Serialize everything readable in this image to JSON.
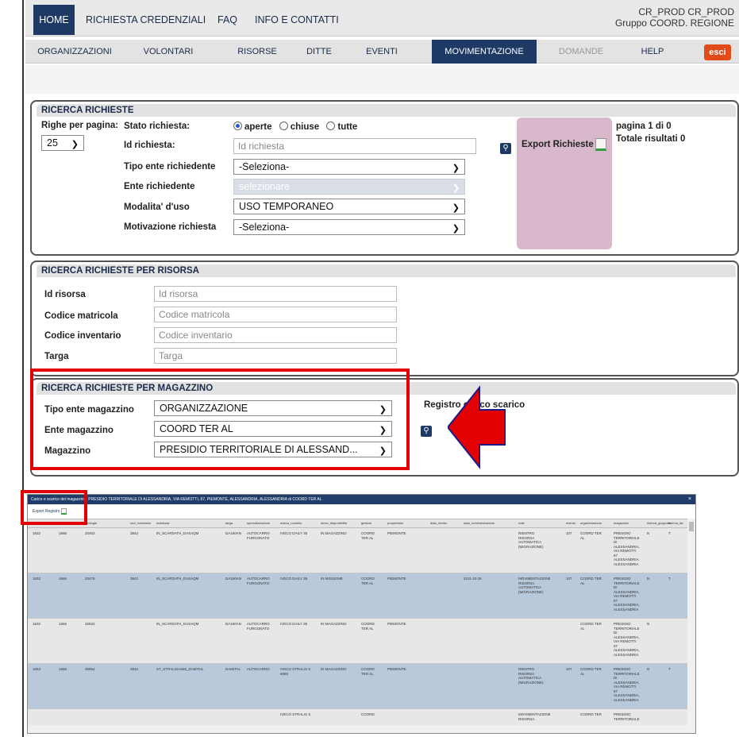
{
  "topbar": {
    "tabs": [
      "HOME",
      "RICHIESTA CREDENZIALI",
      "FAQ",
      "INFO E CONTATTI"
    ],
    "user_line1": "CR_PROD CR_PROD",
    "user_line2": "Gruppo COORD. REGIONE"
  },
  "nav": {
    "items": [
      "ORGANIZZAZIONI",
      "VOLONTARI",
      "RISORSE",
      "DITTE",
      "EVENTI",
      "MOVIMENTAZIONE",
      "DOMANDE",
      "HELP"
    ],
    "active": "MOVIMENTAZIONE",
    "logout": "esci"
  },
  "richieste": {
    "title": "RICERCA RICHIESTE",
    "rows_label": "Righe per pagina:",
    "rows_value": "25",
    "stato_label": "Stato richiesta:",
    "stato_options": [
      "aperte",
      "chiuse",
      "tutte"
    ],
    "id_label": "Id richiesta:",
    "id_placeholder": "Id richiesta",
    "tipo_label": "Tipo ente richiedente",
    "tipo_value": "-Seleziona-",
    "ente_label": "Ente richiedente",
    "ente_value": "selezionare",
    "modalita_label": "Modalita' d'uso",
    "modalita_value": "USO TEMPORANEO",
    "motivazione_label": "Motivazione richiesta",
    "motivazione_value": "-Seleziona-",
    "export_label": "Export Richieste",
    "pagina": "pagina 1 di 0",
    "totale": "Totale risultati 0"
  },
  "risorsa": {
    "title": "RICERCA RICHIESTE PER RISORSA",
    "id_label": "Id risorsa",
    "id_ph": "Id risorsa",
    "matricola_label": "Codice matricola",
    "matricola_ph": "Codice matricola",
    "inventario_label": "Codice inventario",
    "inventario_ph": "Codice inventario",
    "targa_label": "Targa",
    "targa_ph": "Targa"
  },
  "magazzino": {
    "title": "RICERCA RICHIESTE PER MAGAZZINO",
    "tipo_label": "Tipo ente magazzino",
    "tipo_value": "ORGANIZZAZIONE",
    "ente_label": "Ente magazzino",
    "ente_value": "COORD TER AL",
    "mag_label": "Magazzino",
    "mag_value": "PRESIDIO TERRITORIALE DI ALESSAND...",
    "registro": "Registro carico scarico"
  },
  "grid": {
    "title": "Carico e scarico del magazzino: PRESIDIO TERRITORIALE DI ALESSANDRIA, VIA REMOTTI, 67, PIEMONTE, ALESSANDRIA, ALESSANDRIA di COORD TER AL",
    "export": "Export Registro",
    "close": "×",
    "headers": [
      "id",
      "id_r",
      "tipologia",
      "cod_inventario",
      "matricola",
      "targa",
      "specializzazione",
      "marca_modello",
      "descr_disponibilita",
      "gestore",
      "proprietario",
      "data_rientro",
      "data_movimentazione",
      "note",
      "evento",
      "organizzazione",
      "magazzino",
      "riserva_gruppale",
      "riserva_ita"
    ],
    "rows": [
      {
        "c": [
          "1632",
          "1666",
          "20453",
          "3842",
          "IN_SCARDATH_DASAQM",
          "DA160AN",
          "AUTOCARRO\nFURGONATO",
          "IVECO DAILY 35",
          "IN MAGAZZINO",
          "COORD\nTER AL",
          "PIEMONTE",
          "",
          "",
          "RIENTRO\nRISORSA\nAUTOMATICA\n(MIGRAZIONE)",
          "107",
          "COORD TER\nAL",
          "PRESIDIO\nTERRITORIALE\nDI\nALESSANDRIA,\nVIA REMOTTI\n67\nALESSANDRIA,\nALESSANDRIA",
          "N",
          "T"
        ]
      },
      {
        "c": [
          "1632",
          "1666",
          "20479",
          "3842",
          "IN_SCARDATH_DASAQM",
          "DA160AN",
          "AUTOCARRO\nFURGONATO",
          "IVECO DAILY 35",
          "IN MISSIONE",
          "COORD\nTER AL",
          "PIEMONTE",
          "",
          "2011-10-28",
          "MOVIMENTAZIONE\nRISORSA\nAUTOMATICA\n(MIGRAZIONE)",
          "107",
          "COORD TER\nAL",
          "PRESIDIO\nTERRITORIALE\nDI\nALESSANDRIA,\nVIA REMOTTI\n67\nALESSANDRIA,\nALESSANDRIA",
          "N",
          "T"
        ]
      },
      {
        "c": [
          "1632",
          "1666",
          "32522",
          "",
          "IN_SCARDATH_DASAQM",
          "DA160AN",
          "AUTOCARRO\nFURGONATO",
          "IVECO DAILY 35",
          "IN MAGAZZINO",
          "COORD\nTER AL",
          "PIEMONTE",
          "",
          "",
          "",
          "",
          "COORD TER\nAL",
          "PRESIDIO\nTERRITORIALE\nDI\nALESSANDRIA,\nVIA REMOTTI\n67\nALESSANDRIA,\nALESSANDRIA",
          "N",
          ""
        ]
      },
      {
        "c": [
          "1663",
          "1666",
          "36954",
          "3842",
          "ST_STRALISAS65_DA60TAL",
          "DA60TAL",
          "AUTOCARRO",
          "IVECO STRALIS S\n6065",
          "IN MAGAZZINO",
          "COORD\nTER AL",
          "PIEMONTE",
          "",
          "",
          "RIENTRO\nRISORSA\nAUTOMATICA\n(MIGRAZIONE)",
          "107",
          "COORD TER\nAL",
          "PRESIDIO\nTERRITORIALE\nDI\nALESSANDRIA,\nVIA REMOTTI\n67\nALESSANDRIA,\nALESSANDRIA",
          "N",
          "T"
        ]
      },
      {
        "c": [
          "",
          "",
          "",
          "",
          "",
          "",
          "",
          "IVECO STRALIS S",
          "",
          "COORD",
          "",
          "",
          "",
          "MOVIMENTAZIONE\nRISORSA",
          "",
          "COORD TER",
          "PRESIDIO\nTERRITORIALE",
          "",
          ""
        ]
      }
    ]
  }
}
